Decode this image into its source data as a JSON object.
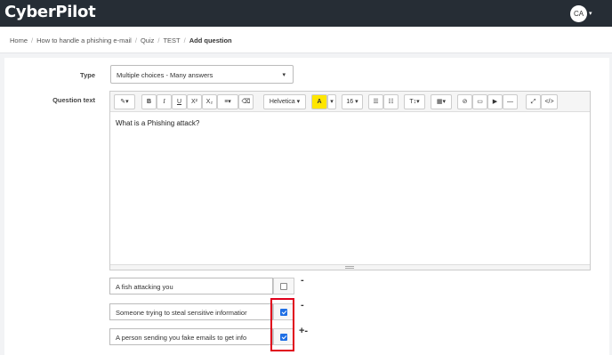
{
  "header": {
    "logo": "CyberPilot",
    "user_initials": "CA",
    "user_caret": "▾"
  },
  "breadcrumb": [
    "Home",
    "How to handle a phishing e-mail",
    "Quiz",
    "TEST"
  ],
  "breadcrumb_current": "Add question",
  "breadcrumb_separator": "/",
  "form": {
    "type_label": "Type",
    "type_value": "Multiple choices - Many answers",
    "type_caret": "▾",
    "question_label": "Question text",
    "question_text": "What is a Phishing attack?"
  },
  "toolbar": {
    "magic": "✎▾",
    "bold": "B",
    "italic": "I",
    "underline": "U",
    "superscript": "X²",
    "subscript": "X₂",
    "align": "≡▾",
    "eraser": "⌫",
    "font": "Helvetica ▾",
    "color_a": "A",
    "color_caret": "▾",
    "size": "16 ▾",
    "ul": "☰",
    "ol": "☷",
    "line_height": "T↕▾",
    "table": "▦▾",
    "link": "⊘",
    "image": "▭",
    "video": "▶",
    "hr": "—",
    "fullscreen": "⤢",
    "code": "</>"
  },
  "answers": [
    {
      "text": "A fish attacking you",
      "checked": false,
      "actions": "-"
    },
    {
      "text": "Someone trying to steal sensitive informatior",
      "checked": true,
      "actions": "-"
    },
    {
      "text": "A person sending you fake emails to get info",
      "checked": true,
      "actions": "+-"
    }
  ],
  "colors": {
    "topbar": "#262d35",
    "checkbox_checked": "#1f6fe5",
    "highlight": "#e0001b",
    "font_color_swatch": "#ffe600"
  }
}
